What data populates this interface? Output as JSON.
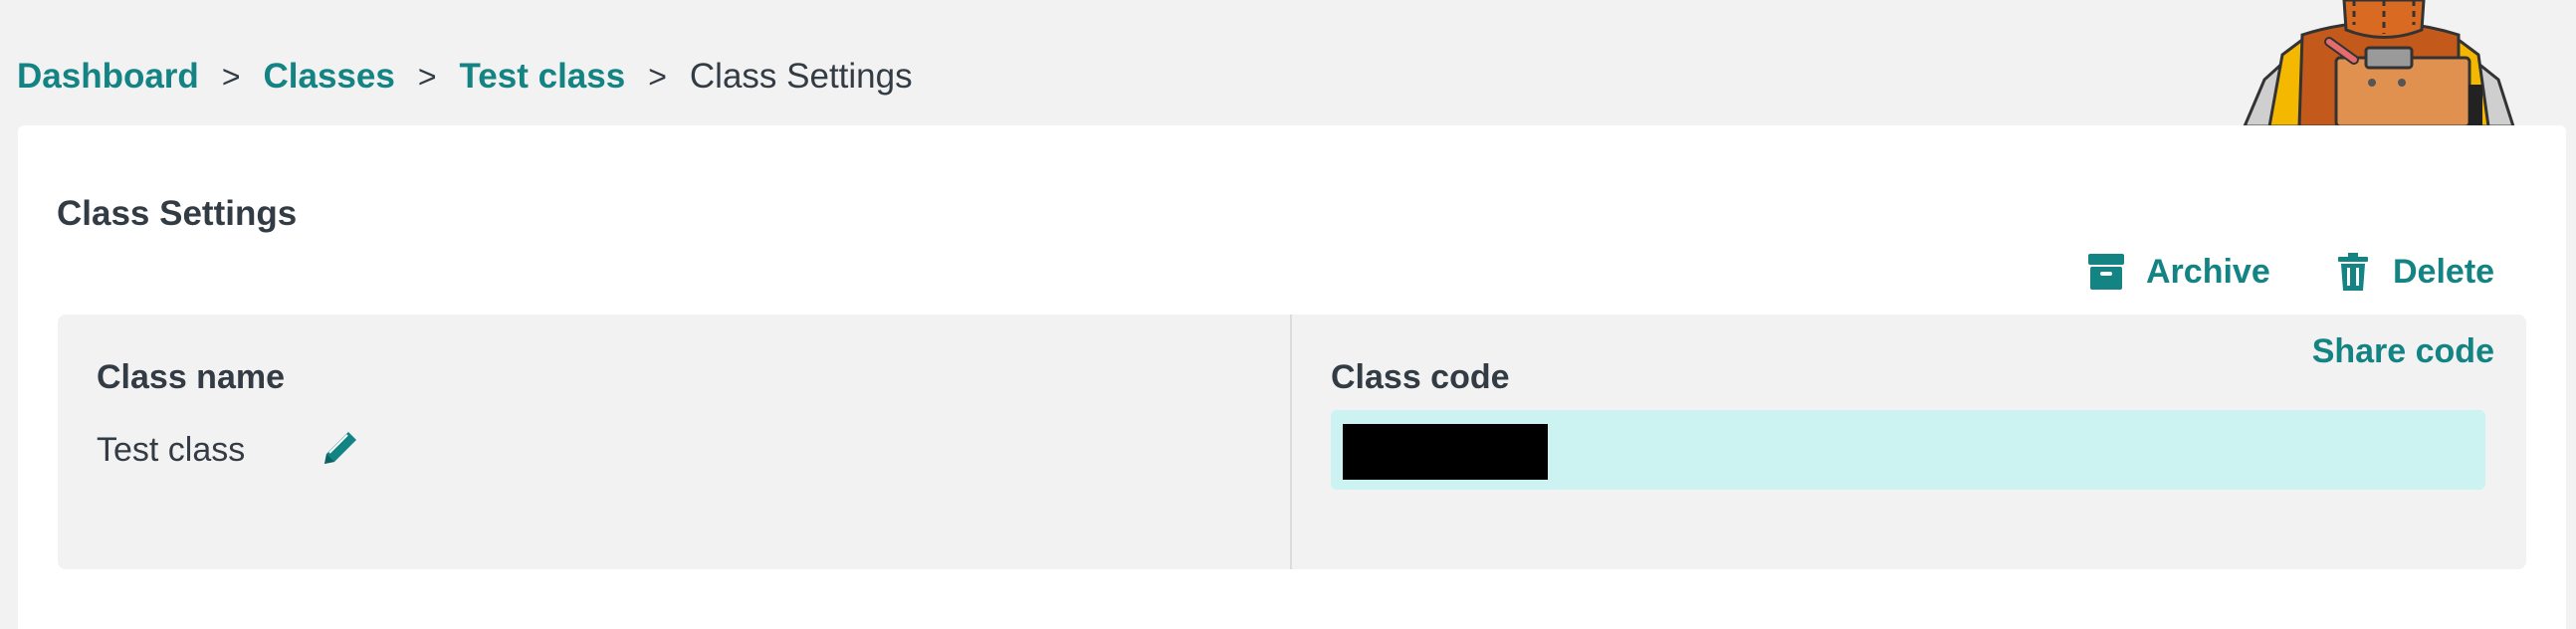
{
  "breadcrumb": {
    "items": [
      "Dashboard",
      "Classes",
      "Test class"
    ],
    "separator": ">",
    "current": "Class Settings"
  },
  "card": {
    "title": "Class Settings",
    "archive_label": "Archive",
    "delete_label": "Delete"
  },
  "class_name": {
    "label": "Class name",
    "value": "Test class"
  },
  "class_code": {
    "label": "Class code",
    "share_label": "Share code"
  },
  "icons": {
    "archive": "archive-box-icon",
    "delete": "trash-icon",
    "edit": "pencil-icon",
    "mascot": "mascot-illustration"
  },
  "colors": {
    "accent": "#138383",
    "code_background": "#cdf2f2",
    "panel_background": "#f2f2f2",
    "text": "#333c44"
  }
}
